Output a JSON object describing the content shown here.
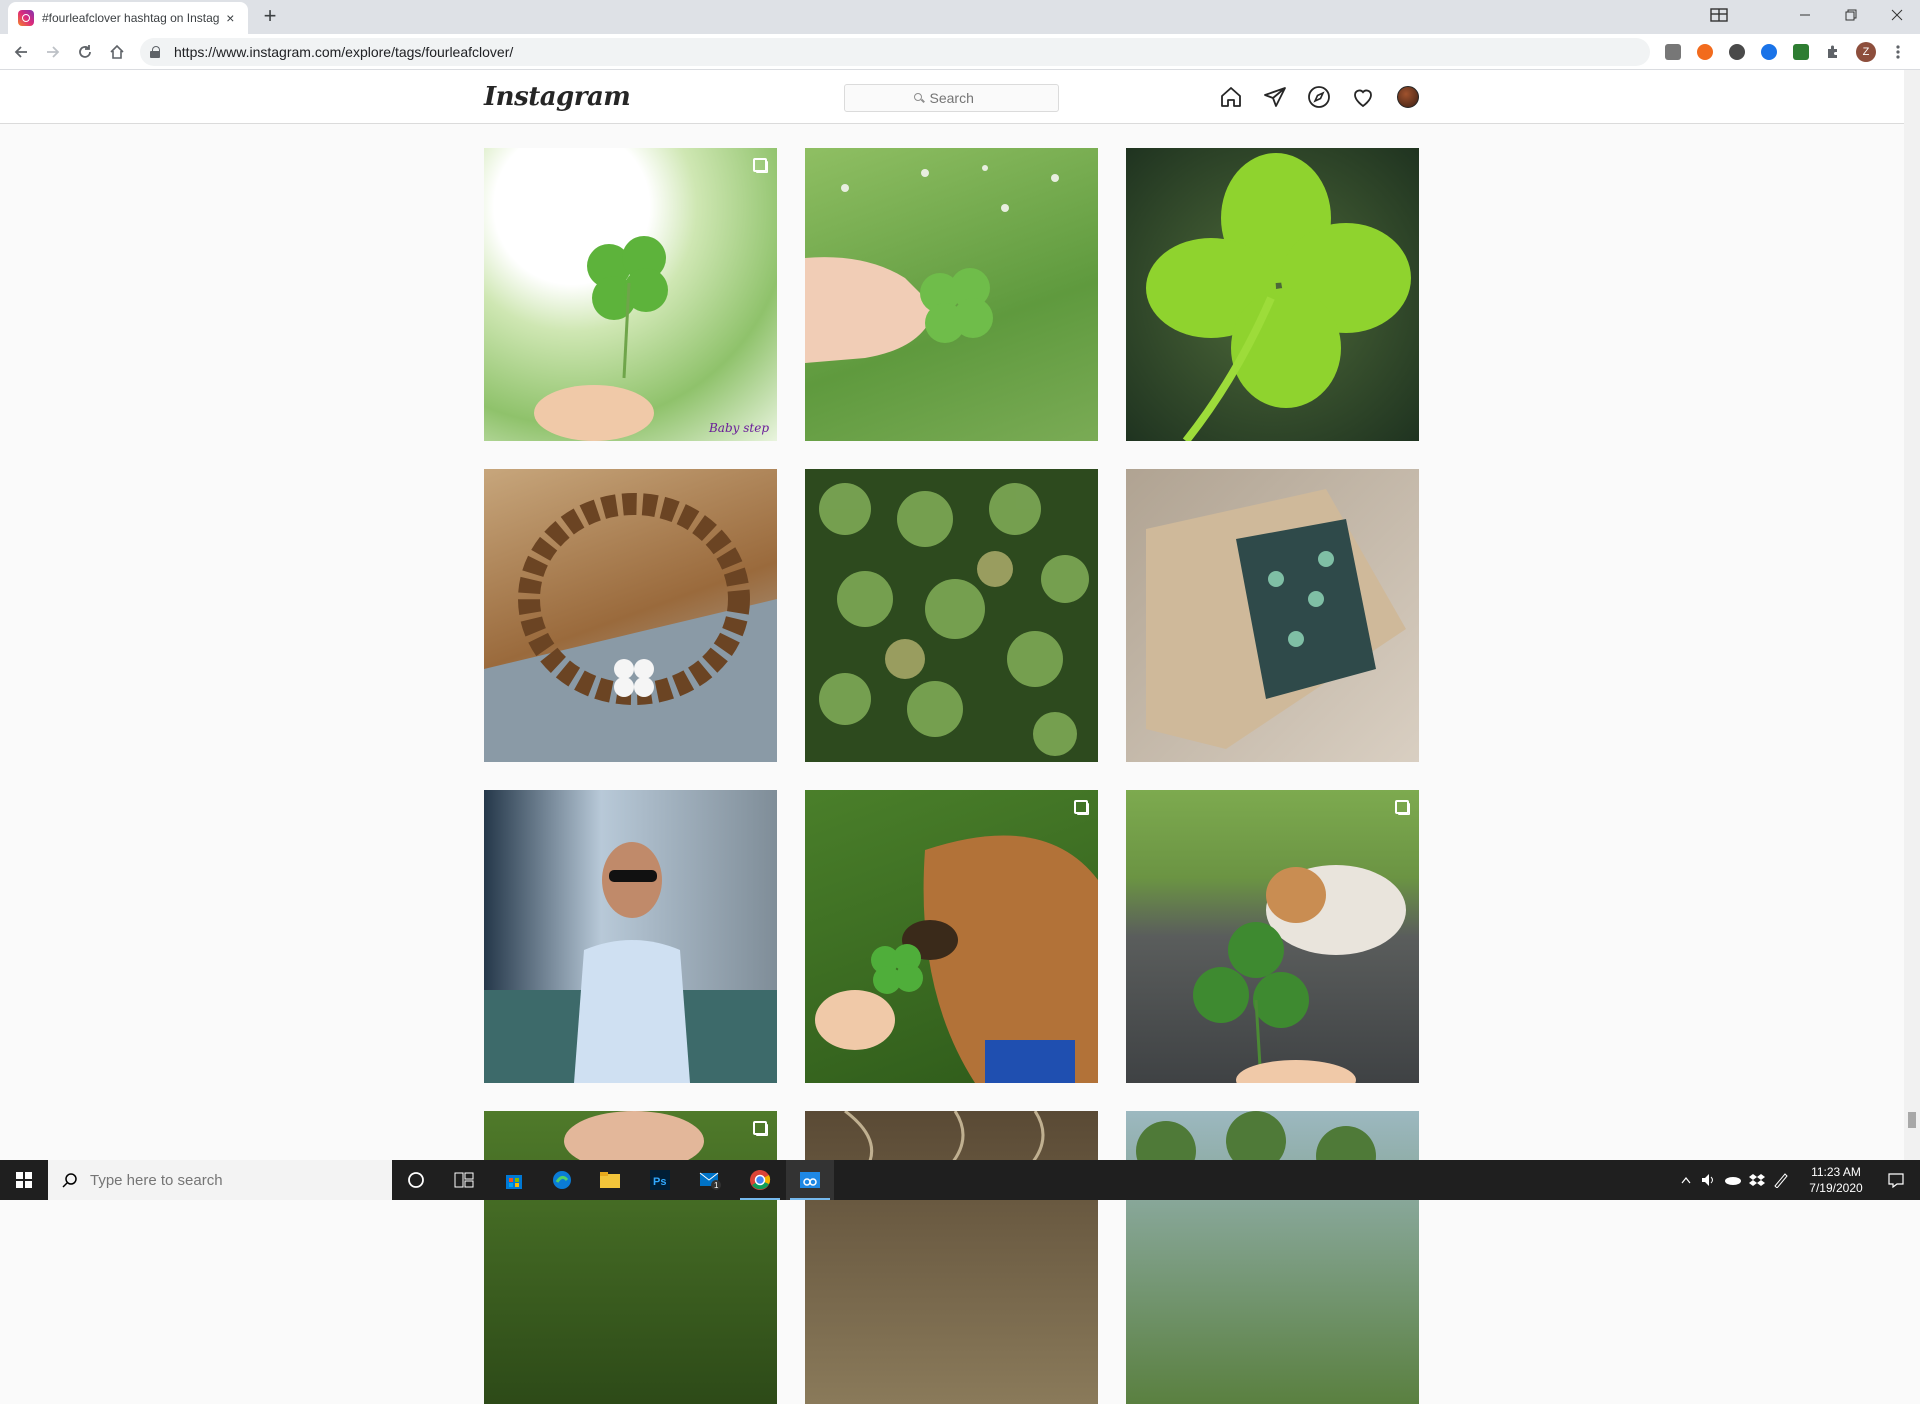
{
  "browser": {
    "tab_title": "#fourleafclover hashtag on Instagram",
    "tab_close": "×",
    "new_tab": "+",
    "url": "https://www.instagram.com/explore/tags/fourleafclover/",
    "profile_initial": "Z"
  },
  "instagram": {
    "logo": "Instagram",
    "search_placeholder": "Search"
  },
  "posts": [
    {
      "alt": "four-leaf clover held in fingers",
      "caption": "Baby step",
      "multi": true
    },
    {
      "alt": "clover held over grass",
      "caption": "",
      "multi": false
    },
    {
      "alt": "close-up four-leaf clover",
      "caption": "",
      "multi": false
    },
    {
      "alt": "wooden bead bracelet with clover charm",
      "caption": "",
      "multi": false
    },
    {
      "alt": "field of clovers",
      "caption": "",
      "multi": false
    },
    {
      "alt": "box of packaged items",
      "caption": "",
      "multi": false
    },
    {
      "alt": "man in sunglasses",
      "caption": "",
      "multi": false
    },
    {
      "alt": "dog sniffing a clover",
      "caption": "",
      "multi": true
    },
    {
      "alt": "clover held in front of dog",
      "caption": "",
      "multi": true
    },
    {
      "alt": "hand in grass",
      "caption": "",
      "multi": true
    },
    {
      "alt": "plants",
      "caption": "",
      "multi": false
    },
    {
      "alt": "greenery",
      "caption": "",
      "multi": false
    }
  ],
  "taskbar": {
    "search_placeholder": "Type here to search",
    "mail_badge": "1",
    "time": "11:23 AM",
    "date": "7/19/2020"
  }
}
